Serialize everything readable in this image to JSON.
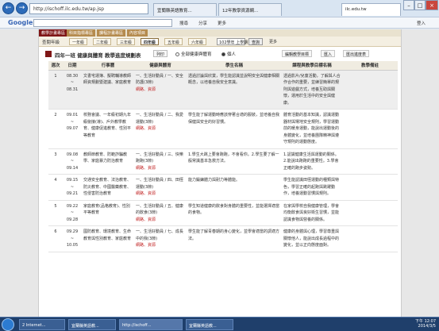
{
  "browser": {
    "address": "http://ischoff.ilc.edu.tw/ap.jsp",
    "tabs": [
      {
        "label": "宜蘭縣英語教育..."
      },
      {
        "label": "12年教學資源網..."
      },
      {
        "label": "ilc.edu.tw"
      }
    ],
    "toolbar_search_label": "Google",
    "toolbar_items": [
      "搜尋",
      "分享",
      "更多",
      "登入"
    ]
  },
  "system_nav": [
    "教學計畫專區",
    "科目指標專區",
    "課程計畫專區",
    "內容項目"
  ],
  "grade_bar": {
    "label": "查閱年級",
    "grades": [
      "一年級",
      "二年級",
      "三年級",
      "四年級",
      "五年級",
      "六年級"
    ],
    "selected": "四年級",
    "year": "102學年 上學期",
    "go_label": "查詢",
    "more_label": "更多"
  },
  "header": {
    "title": "四年一班 健康與體育 教學進度規劃表",
    "print_label": "列印",
    "radio_all": "全部健康與體育",
    "radio_personal": "個人",
    "action_edit": "編輯教學目標",
    "action_import": "匯入",
    "action_export": "匯出進度表"
  },
  "table": {
    "columns": [
      "週次",
      "日期",
      "行事曆",
      "健康與體育",
      "學生名稱",
      "課程與教學目標名稱",
      "教學備註"
    ],
    "rows": [
      {
        "week": "1",
        "date_from": "08.30",
        "date_to": "08.31",
        "calendar": "文書宅運簿、擬聘輔導教師師資規劃暨建議、家庭教育",
        "unit": "一、生活好動員 / 一、安全防護(3節)",
        "tag": "網路、資源",
        "goal": "透過討論與欣賞，學生能認識並說明安全與健康相關概念，以培養自我安全意識。",
        "target": "透過影片/兒童活動，了解與人合作合作的重要，並練習簡單的規則與遊戲方式，培養互助與關懷，運用於生活中的安全與健康。"
      },
      {
        "week": "2",
        "date_from": "09.01",
        "date_to": "09.07",
        "calendar": "校務會議、一年級初期九年級銜接(導)、戶外教學教育、健康促進教育、性別平等教育",
        "unit": "一、生活好動員 / 二、我愛運動(3節)",
        "tag": "網路、資源",
        "goal": "學生能了解運動時應該穿著合適的服裝，並培養自我保健與安全的好習慣。",
        "target": "體育活動的基本知識，認識運動器材與場地安全規則，學習運動前的暖身運動，能說出運動後的身體變化，並培養團隊精神與遵守規則的運動態度。"
      },
      {
        "week": "3",
        "date_from": "09.08",
        "date_to": "09.14",
        "calendar": "教師節教育、防範詐騙教學、家庭暴力防治教育",
        "unit": "一、生活好動員 / 三、快樂跑跑(3節)",
        "tag": "網路、資源",
        "goal": "1.學生大跳上要會跑跑，不會看你。2.學生要了解一般常識基本急救方法。",
        "target": "1.認識健康生活與運動的關係。2.能說出跑跑的重要性。3.學會正確的跑步姿勢。"
      },
      {
        "week": "4",
        "date_from": "09.15",
        "date_to": "09.21",
        "calendar": "交通安全教育、法治教育、防災教育、中國醫藥教育、性侵害防治教育",
        "unit": "一、生活好動員 / 四、田徑運動(3節)",
        "tag": "網路、資源",
        "goal": "能力鍛鍊體力與耐力等體能。",
        "target": "學生能認識田徑運動的種類與特色，學習正確的起跑與跳躍動作，培養運動習慣與規則。"
      },
      {
        "week": "5",
        "date_from": "09.22",
        "date_to": "09.28",
        "calendar": "家庭教育(品格教育)、性別平等教育",
        "unit": "一、生活好動員 / 五、健康的飲食(3節)",
        "tag": "網路、資源",
        "goal": "學生知道健康的飲食對身體的重要性，並能選擇適當的食物。",
        "target": "在家與學校自我健康管理，學會均衡飲食與良好衛生習慣，並能認識食物與營養的關係。"
      },
      {
        "week": "6",
        "date_from": "09.29",
        "date_to": "10.05",
        "calendar": "國防教育、環境教育、生命教育與性別教育、家庭教育",
        "unit": "一、生活好動員 / 七、成長中的我(3節)",
        "tag": "網路、資源",
        "goal": "學生能了解青春期的身心變化，並學會適當的調適方法。",
        "target": "健康的身體與心理，學習尊重與關懷他人，能說出成長過程中的變化，並以正向態度面對。"
      }
    ]
  },
  "taskbar": {
    "items": [
      "2 Internet...",
      "宜蘭縣英語教...",
      "http://ischoff...",
      "宜蘭縣英語教..."
    ],
    "time": "下午 12:07",
    "date": "2014/3/5"
  }
}
